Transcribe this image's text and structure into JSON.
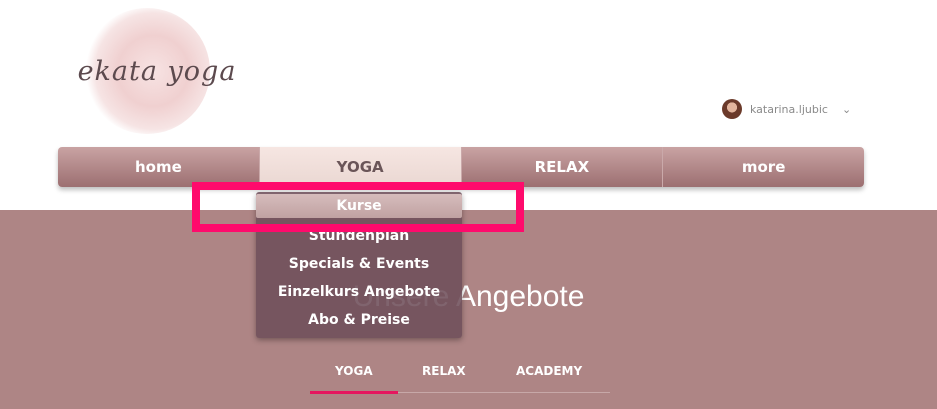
{
  "brand": {
    "logo_text": "ekata yoga"
  },
  "user": {
    "name": "katarina.ljubic",
    "chevron_icon": "chevron-down-icon",
    "avatar_icon": "avatar"
  },
  "nav": {
    "items": [
      {
        "label": "home",
        "active": false
      },
      {
        "label": "YOGA",
        "active": true
      },
      {
        "label": "RELAX",
        "active": false
      },
      {
        "label": "more",
        "active": false
      }
    ]
  },
  "dropdown": {
    "items": [
      {
        "label": "Kurse",
        "active": true
      },
      {
        "label": "Stundenplan"
      },
      {
        "label": "Specials & Events"
      },
      {
        "label": "Einzelkurs Angebote"
      },
      {
        "label": "Abo & Preise"
      }
    ]
  },
  "section": {
    "title": "Unsere Angebote",
    "tabs": [
      {
        "label": "YOGA",
        "active": true
      },
      {
        "label": "RELAX"
      },
      {
        "label": "ACADEMY"
      }
    ]
  },
  "colors": {
    "accent": "#ff0a6c",
    "nav_bg": "#ae7f80",
    "section_bg": "#ae8585",
    "tab_underline": "#e5175f"
  }
}
